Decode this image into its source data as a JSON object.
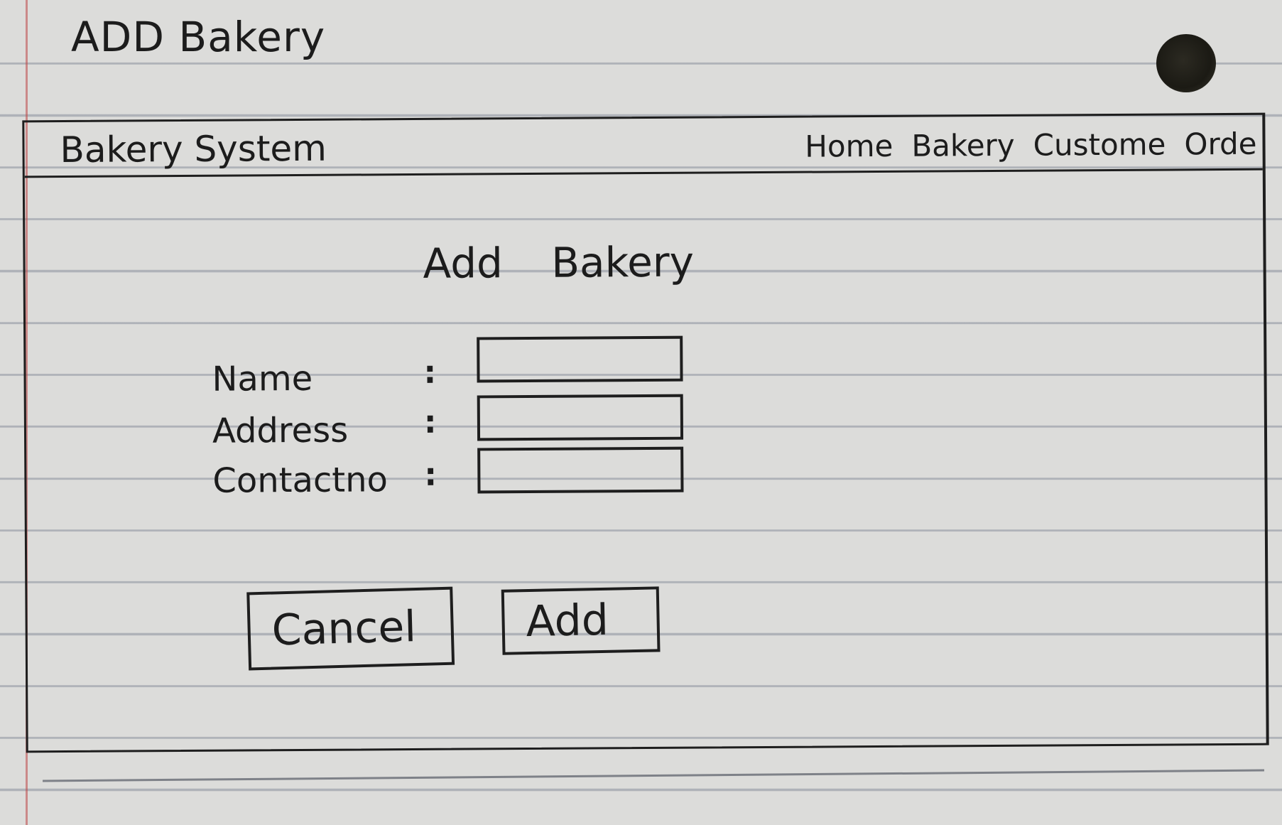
{
  "sheet": {
    "title": "ADD Bakery"
  },
  "navbar": {
    "brand": "Bakery System",
    "links": [
      {
        "label": "Home"
      },
      {
        "label": "Bakery"
      },
      {
        "label": "Custome"
      },
      {
        "label": "Orde"
      }
    ]
  },
  "form": {
    "heading": "Add Bakery",
    "fields": [
      {
        "label": "Name",
        "colon": ":",
        "value": ""
      },
      {
        "label": "Address",
        "colon": ":",
        "value": ""
      },
      {
        "label": "Contactno",
        "colon": ":",
        "value": ""
      }
    ],
    "cancel_label": "Cancel",
    "add_label": "Add"
  }
}
